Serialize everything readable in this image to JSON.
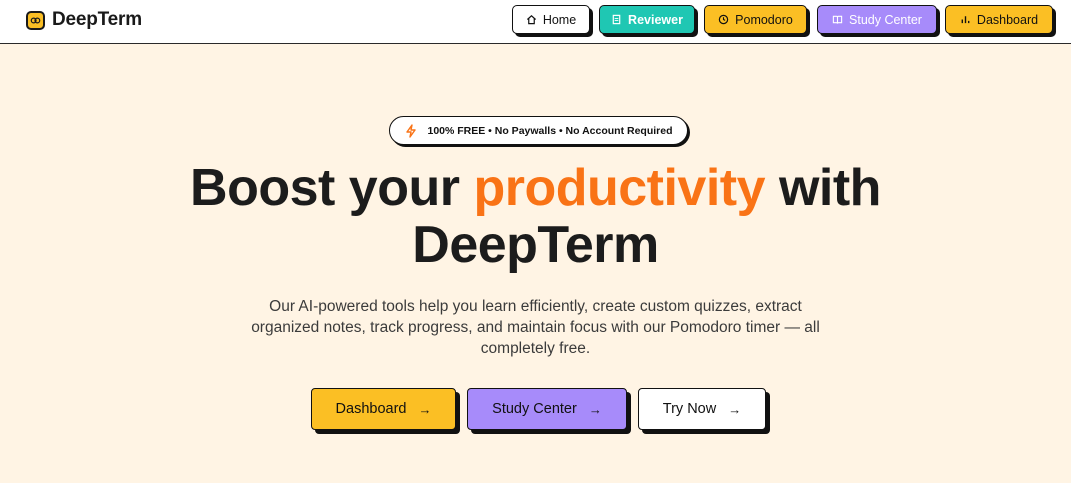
{
  "brand": {
    "name": "DeepTerm",
    "logo_icon": "brain-icon",
    "logo_color": "#fbbf24"
  },
  "nav": {
    "home": {
      "label": "Home",
      "icon": "home-icon"
    },
    "reviewer": {
      "label": "Reviewer",
      "icon": "document-icon",
      "color": "#1fc7b3"
    },
    "pomodoro": {
      "label": "Pomodoro",
      "icon": "clock-icon",
      "color": "#fbbf24"
    },
    "study_center": {
      "label": "Study Center",
      "icon": "book-icon",
      "color": "#a78bfa"
    },
    "dashboard": {
      "label": "Dashboard",
      "icon": "bar-chart-icon",
      "color": "#fbbf24"
    }
  },
  "hero": {
    "badge": "100% FREE • No Paywalls • No Account Required",
    "badge_icon": "lightning-icon",
    "title_prefix": "Boost your",
    "title_accent": "productivity",
    "title_suffix": "with DeepTerm",
    "accent_color": "#f97316",
    "description": "Our AI-powered tools help you learn efficiently, create custom quizzes, extract organized notes, track progress, and maintain focus with our Pomodoro timer — all completely free."
  },
  "cta": {
    "dashboard": "Dashboard",
    "study_center": "Study Center",
    "try_now": "Try Now",
    "arrow": "→"
  },
  "colors": {
    "background": "#fff4e4",
    "text": "#1c1c1c"
  }
}
